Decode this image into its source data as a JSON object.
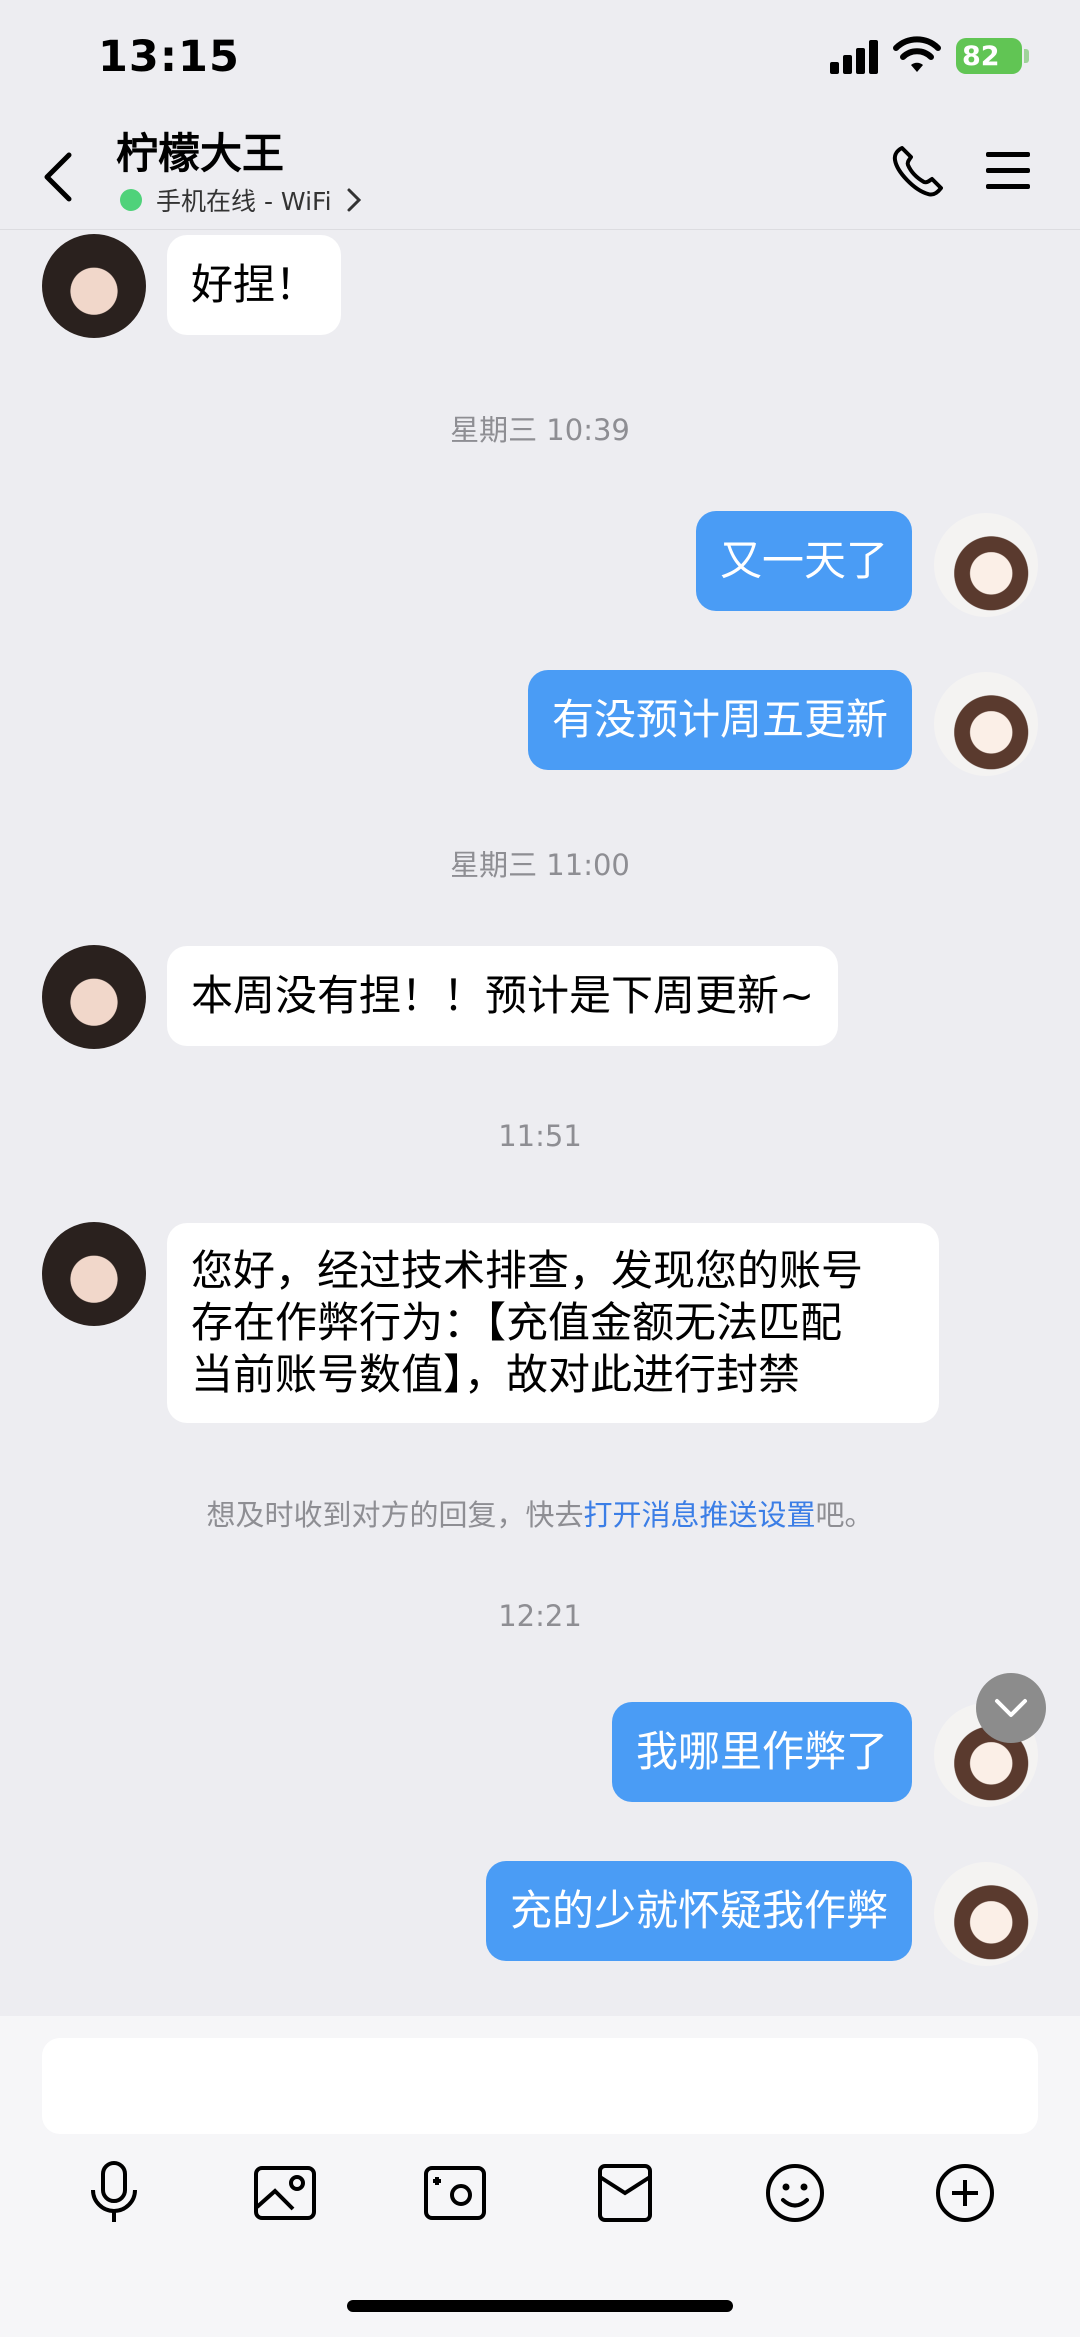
{
  "status_bar": {
    "time": "13:15",
    "battery": "82"
  },
  "header": {
    "title": "柠檬大王",
    "status": "手机在线 - WiFi"
  },
  "messages": [
    {
      "kind": "in",
      "text": "好捏！"
    },
    {
      "kind": "timestamp",
      "text": "星期三 10:39"
    },
    {
      "kind": "out",
      "text": "又一天了"
    },
    {
      "kind": "out",
      "text": "有没预计周五更新"
    },
    {
      "kind": "timestamp",
      "text": "星期三 11:00"
    },
    {
      "kind": "in",
      "text": "本周没有捏！！预计是下周更新~"
    },
    {
      "kind": "timestamp",
      "text": "11:51"
    },
    {
      "kind": "in",
      "lines": [
        "您好，经过技术排查，发现您的账号",
        "存在作弊行为：【充值金额无法匹配",
        "当前账号数值】，故对此进行封禁"
      ]
    },
    {
      "kind": "notice",
      "prefix": "想及时收到对方的回复，快去",
      "link": "打开消息推送设置",
      "suffix": "吧。"
    },
    {
      "kind": "timestamp",
      "text": "12:21"
    },
    {
      "kind": "out",
      "text": "我哪里作弊了"
    },
    {
      "kind": "out",
      "text": "充的少就怀疑我作弊"
    }
  ],
  "input": {
    "value": ""
  },
  "toolbar": [
    "microphone-icon",
    "image-icon",
    "camera-icon",
    "red-packet-icon",
    "emoji-icon",
    "plus-icon"
  ],
  "colors": {
    "outgoing": "#4a9cf5",
    "link": "#3b7ee6",
    "online": "#4fd27a"
  }
}
